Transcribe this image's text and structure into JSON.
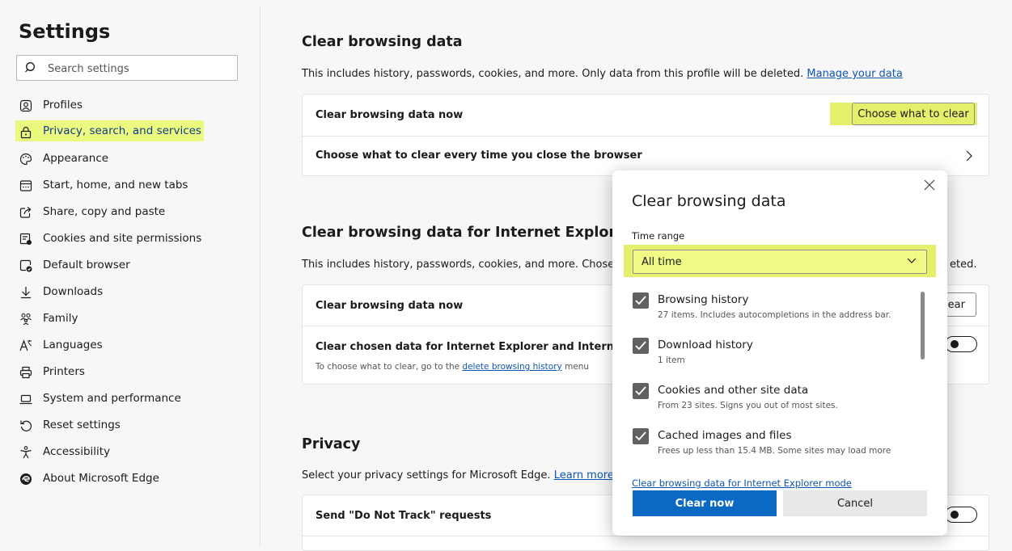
{
  "sidebar": {
    "title": "Settings",
    "search_placeholder": "Search settings",
    "items": [
      {
        "label": "Profiles",
        "icon": "profile-icon"
      },
      {
        "label": "Privacy, search, and services",
        "icon": "lock-icon",
        "active": true
      },
      {
        "label": "Appearance",
        "icon": "palette-icon"
      },
      {
        "label": "Start, home, and new tabs",
        "icon": "home-tab-icon"
      },
      {
        "label": "Share, copy and paste",
        "icon": "share-icon"
      },
      {
        "label": "Cookies and site permissions",
        "icon": "cookies-icon"
      },
      {
        "label": "Default browser",
        "icon": "default-browser-icon"
      },
      {
        "label": "Downloads",
        "icon": "download-icon"
      },
      {
        "label": "Family",
        "icon": "family-icon"
      },
      {
        "label": "Languages",
        "icon": "languages-icon"
      },
      {
        "label": "Printers",
        "icon": "printer-icon"
      },
      {
        "label": "System and performance",
        "icon": "laptop-icon"
      },
      {
        "label": "Reset settings",
        "icon": "reset-icon"
      },
      {
        "label": "Accessibility",
        "icon": "accessibility-icon"
      },
      {
        "label": "About Microsoft Edge",
        "icon": "edge-icon"
      }
    ]
  },
  "main": {
    "section1": {
      "title": "Clear browsing data",
      "desc": "This includes history, passwords, cookies, and more. Only data from this profile will be deleted.",
      "link": "Manage your data",
      "row1": "Clear browsing data now",
      "row1_button": "Choose what to clear",
      "row2": "Choose what to clear every time you close the browser"
    },
    "section2": {
      "title": "Clear browsing data for Internet Explorer",
      "desc": "This includes history, passwords, cookies, and more. Chosen",
      "desc_tail": "eted.",
      "row1": "Clear browsing data now",
      "row1_button_partial": "lear",
      "row2": "Clear chosen data for Internet Explorer and Internet Exp",
      "row2_sub_prefix": "To choose what to clear, go to the",
      "row2_sub_link": "delete browsing history",
      "row2_sub_suffix": "menu"
    },
    "section3": {
      "title": "Privacy",
      "desc": "Select your privacy settings for Microsoft Edge.",
      "link": "Learn more",
      "row1": "Send \"Do Not Track\" requests"
    }
  },
  "dialog": {
    "title": "Clear browsing data",
    "time_range_label": "Time range",
    "time_range_value": "All time",
    "options": [
      {
        "title": "Browsing history",
        "sub": "27 items. Includes autocompletions in the address bar.",
        "checked": true
      },
      {
        "title": "Download history",
        "sub": "1 item",
        "checked": true
      },
      {
        "title": "Cookies and other site data",
        "sub": "From 23 sites. Signs you out of most sites.",
        "checked": true
      },
      {
        "title": "Cached images and files",
        "sub": "Frees up less than 15.4 MB. Some sites may load more",
        "checked": true
      }
    ],
    "ie_link": "Clear browsing data for Internet Explorer mode",
    "primary_button": "Clear now",
    "secondary_button": "Cancel"
  },
  "colors": {
    "highlight": "#ecf97f",
    "accent": "#0b69c4",
    "link": "#0f55b8"
  }
}
